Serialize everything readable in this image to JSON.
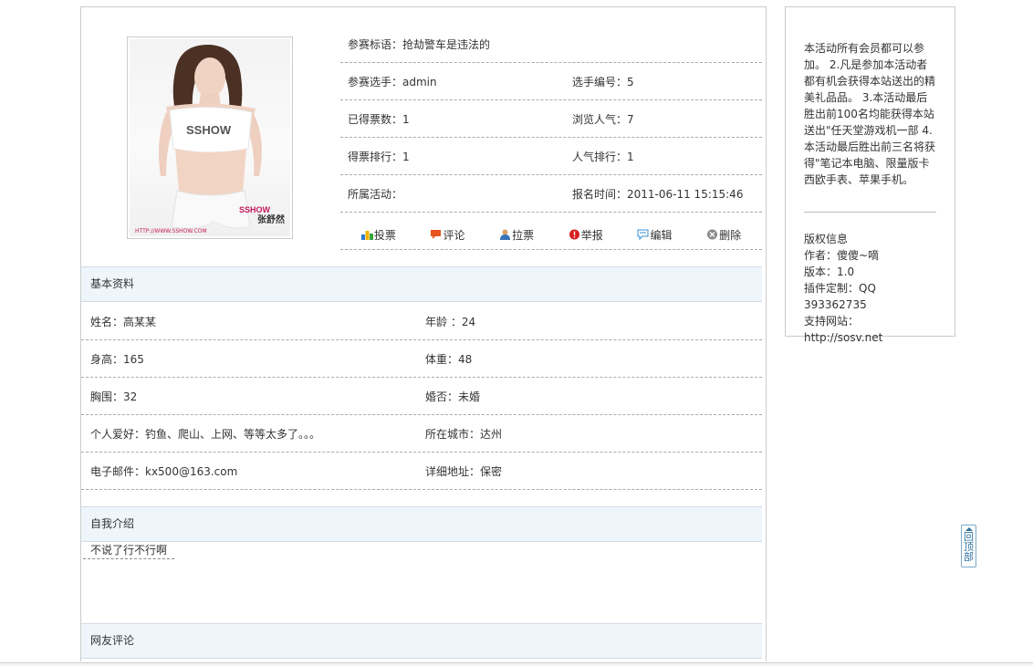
{
  "profile": {
    "photo_caption_brand": "SSHOW",
    "photo_caption_name": "张舒然",
    "photo_caption_url": "HTTP://WWW.SSHOW.COM"
  },
  "info": {
    "slogan": "参赛标语：抢劫警车是违法的",
    "contestant": "参赛选手：admin",
    "number": "选手编号：5",
    "votes": "已得票数：1",
    "views": "浏览人气：7",
    "vote_rank": "得票排行：1",
    "popularity_rank": "人气排行：1",
    "activity": "所属活动：",
    "signup_time": "报名时间：2011-06-11 15:15:46"
  },
  "actions": {
    "vote": "投票",
    "comment": "评论",
    "canvass": "拉票",
    "report": "举报",
    "edit": "编辑",
    "delete": "删除"
  },
  "basic": {
    "title": "基本资料",
    "name": "姓名：高某某",
    "age": "年龄 ：24",
    "height": "身高：165",
    "weight": "体重：48",
    "bust": "胸围：32",
    "married": "婚否：未婚",
    "hobby": "个人爱好：钓鱼、爬山、上网、等等太多了。。。",
    "city": "所在城市：达州",
    "email": "电子邮件：kx500@163.com",
    "address": "详细地址：保密"
  },
  "intro": {
    "title": "自我介绍",
    "text": "不说了行不行啊"
  },
  "comments": {
    "title": "网友评论"
  },
  "sidebar": {
    "notice": "本活动所有会员都可以参加。 2.凡是参加本活动者都有机会获得本站送出的精美礼品品。 3.本活动最后胜出前100名均能获得本站送出\"任天堂游戏机一部 4.本活动最后胜出前三名将获得\"笔记本电脑、限量版卡西欧手表、苹果手机。",
    "copyright_title": "版权信息",
    "author": "作者：傻傻~嘀",
    "version": "版本：1.0",
    "plugin": "插件定制：QQ 393362735",
    "website": "支持网站：http://sosv.net"
  },
  "back_to_top": "回顶部",
  "colors": {
    "section_bg": "#eef6fc",
    "border": "#cccccc",
    "link_blue": "#2d6f9c"
  }
}
